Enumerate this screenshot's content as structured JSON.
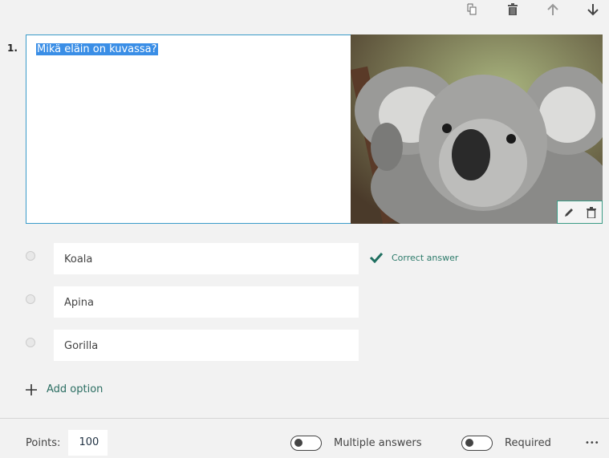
{
  "toolbar": {
    "icons": [
      "copy-icon",
      "trash-icon",
      "arrow-up-icon",
      "arrow-down-icon"
    ]
  },
  "question": {
    "number": "1.",
    "text": "Mikä eläin on kuvassa?",
    "image_alt_icon": "koala-image"
  },
  "options": [
    {
      "label": "Koala",
      "correct": true
    },
    {
      "label": "Apina",
      "correct": false
    },
    {
      "label": "Gorilla",
      "correct": false
    }
  ],
  "correct_answer_label": "Correct answer",
  "add_option_label": "Add option",
  "footer": {
    "points_label": "Points:",
    "points_value": "100",
    "multiple_answers_label": "Multiple answers",
    "multiple_answers_on": false,
    "required_label": "Required",
    "required_on": false,
    "more_label": "•••"
  },
  "colors": {
    "accent": "#2c7a6a",
    "selection": "#3a8ee6",
    "border": "#3a9bc9"
  }
}
